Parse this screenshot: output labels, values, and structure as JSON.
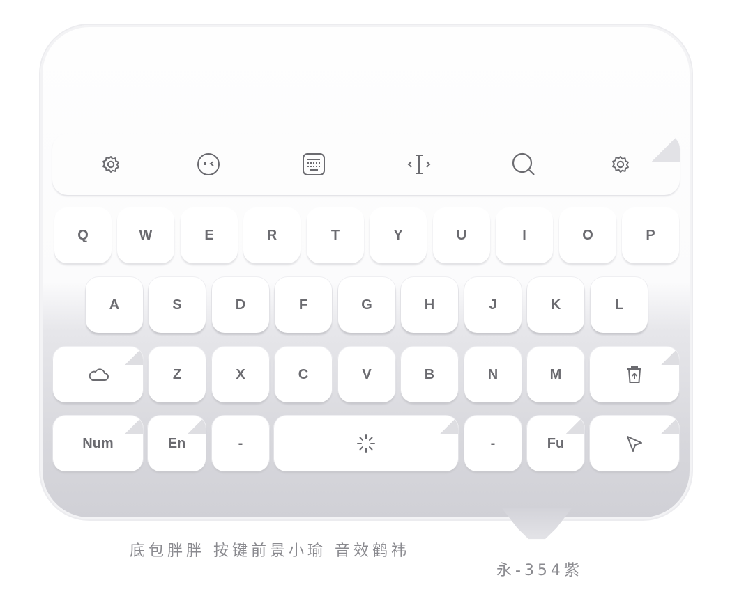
{
  "toolbar": {
    "icons": [
      "settings-icon",
      "emoji-icon",
      "keyboard-layout-icon",
      "text-cursor-icon",
      "search-icon",
      "settings-icon"
    ]
  },
  "keyboard": {
    "row1": [
      "Q",
      "W",
      "E",
      "R",
      "T",
      "Y",
      "U",
      "I",
      "O",
      "P"
    ],
    "row2": [
      "A",
      "S",
      "D",
      "F",
      "G",
      "H",
      "J",
      "K",
      "L"
    ],
    "row3": [
      "Z",
      "X",
      "C",
      "V",
      "B",
      "N",
      "M"
    ],
    "row4": {
      "num": "Num",
      "en": "En",
      "left_dash": "-",
      "right_dash": "-",
      "fu": "Fu"
    },
    "icons": {
      "cloud": "cloud-icon",
      "delete": "trash-icon",
      "space": "loading-spinner-icon",
      "send": "send-arrow-icon"
    }
  },
  "captions": {
    "credits": "底包胖胖 按键前景小瑜 音效鹤祎",
    "author": "永-354紫"
  },
  "colors": {
    "key_text": "#6b6b70",
    "key_face": "#ffffff",
    "panel_bottom": "#d0d0d6"
  }
}
